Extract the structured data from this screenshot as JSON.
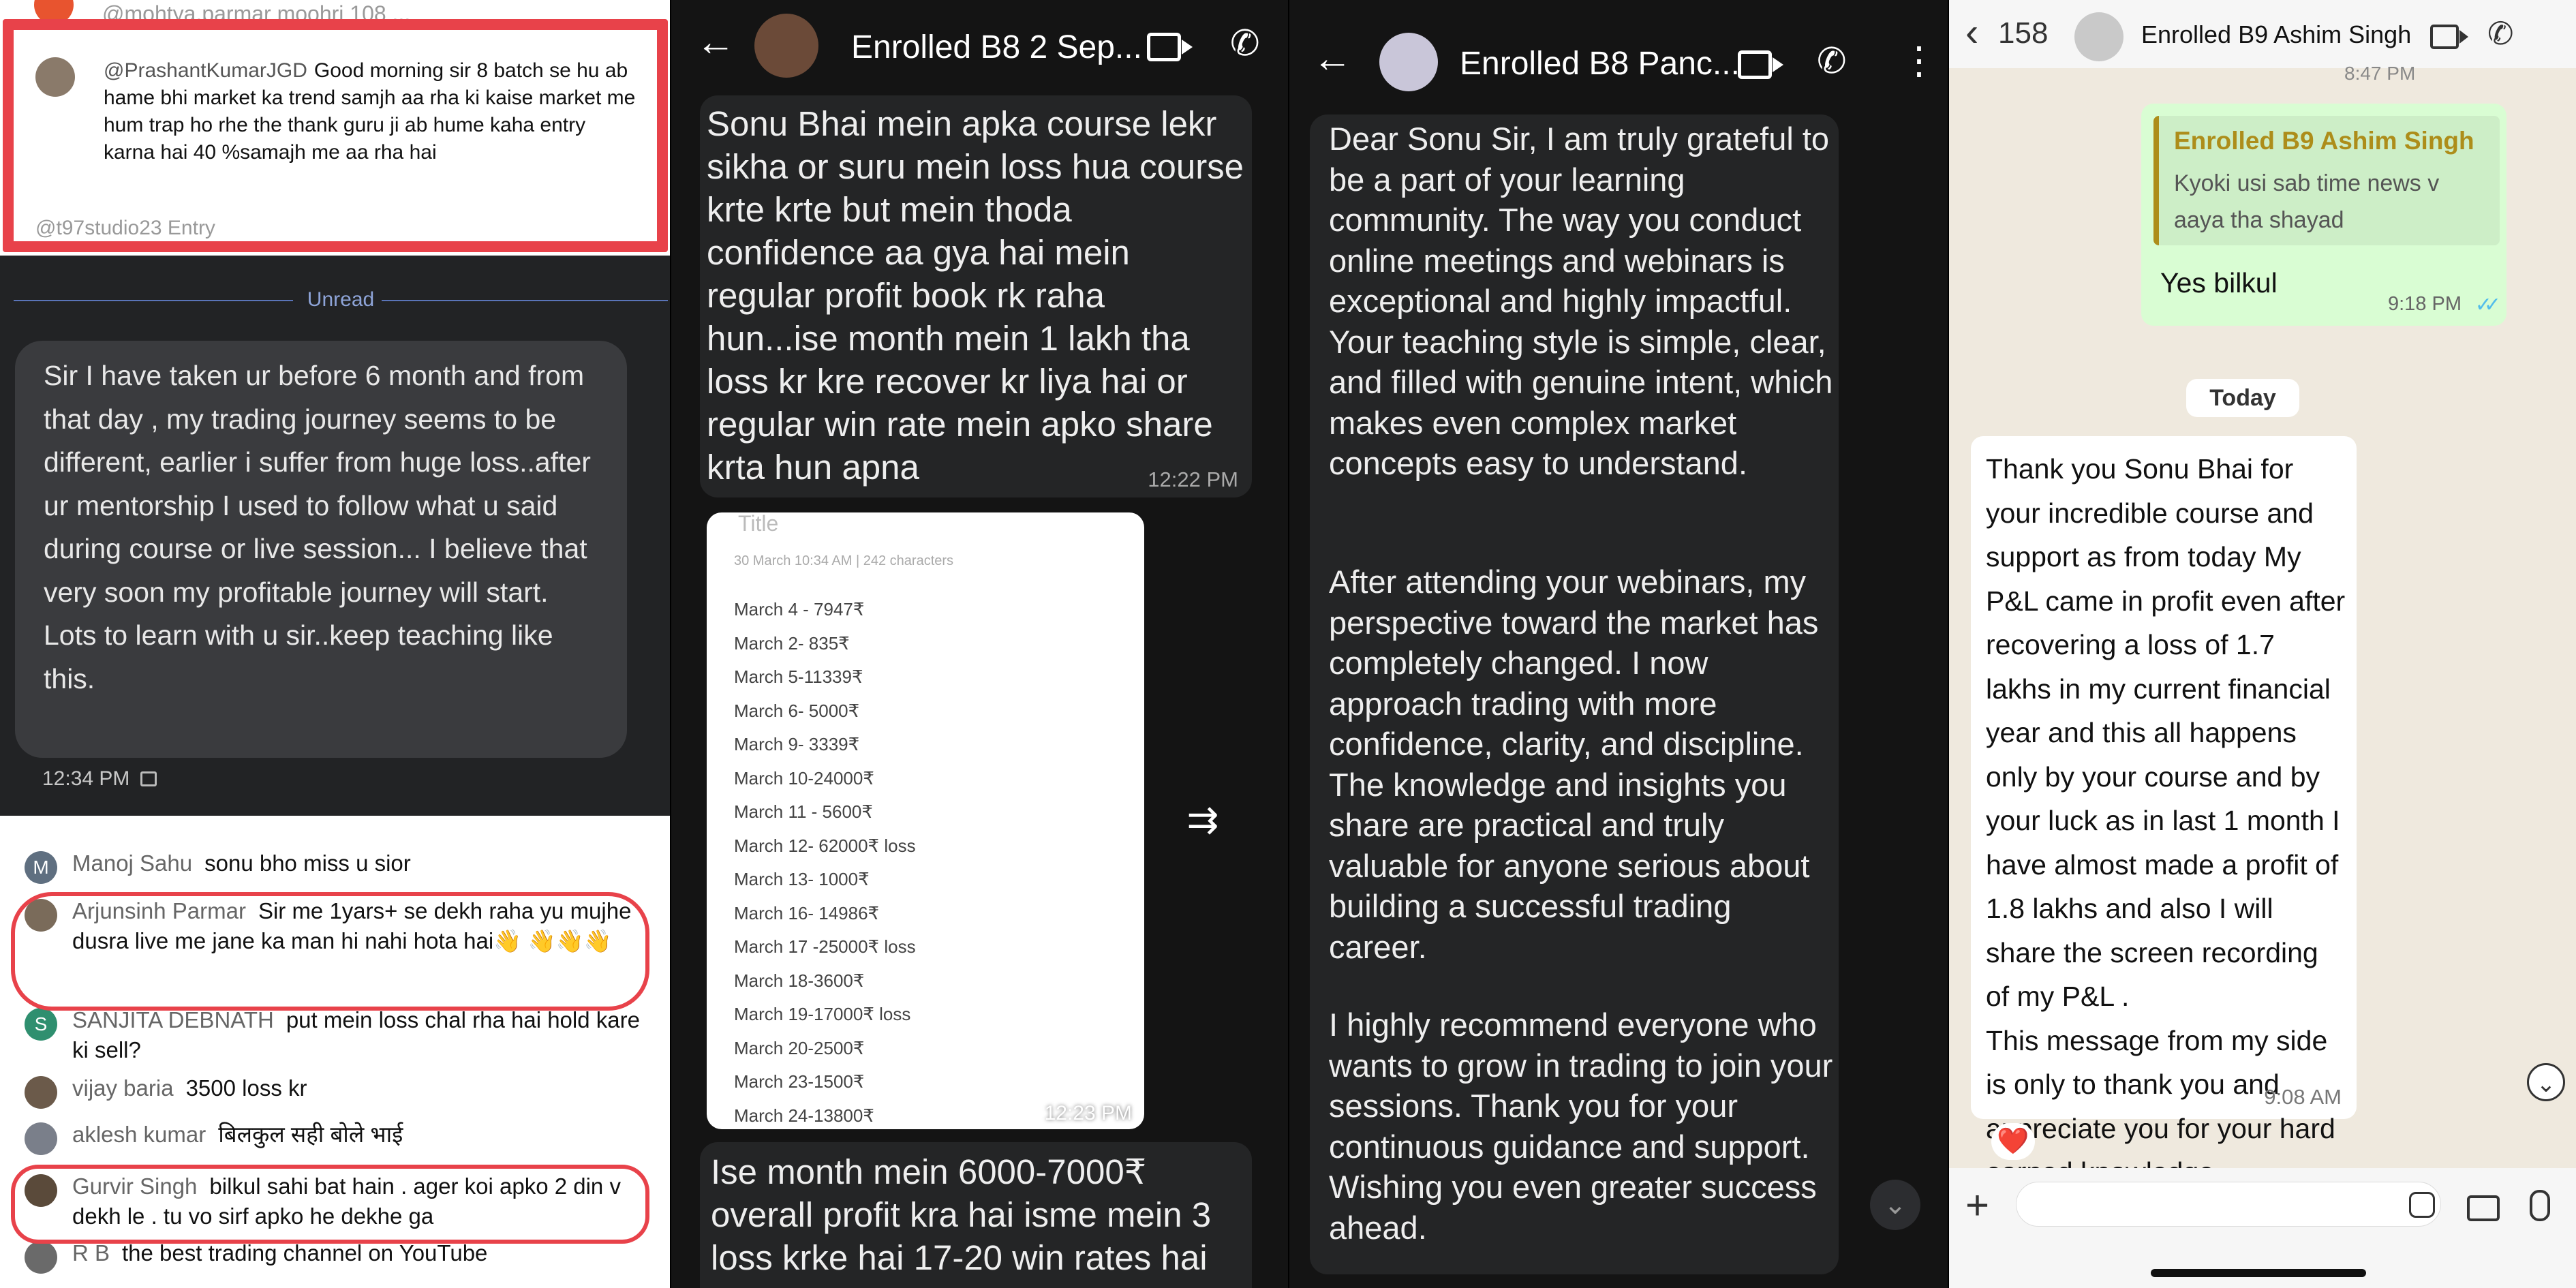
{
  "panel1": {
    "top_cut_text": "@mohtya.parmar  moohri   108  ...",
    "top_comment": {
      "handle": "@PrashantKumarJGD",
      "text": "Good morning sir 8 batch se hu ab hame bhi market ka trend samjh aa rha ki kaise market me hum trap ho rhe the thank guru ji ab hume kaha entry karna hai 40 %samajh me aa rha hai"
    },
    "cut_comment": "@t97studio23  Entry",
    "unread_label": "Unread",
    "message": "Sir I have taken ur before 6 month and from that day , my trading journey seems to be different, earlier i suffer from huge loss..after ur mentorship I used to follow what u said during course or live session... I believe that very soon my profitable journey will start.\nLots to learn with u sir..keep teaching like this.",
    "message_time": "12:34 PM",
    "comments": [
      {
        "avatar": "M",
        "color": "#5f6f80",
        "name": "Manoj Sahu",
        "text": "sonu bho miss u sior"
      },
      {
        "avatar": "",
        "color": "#7a6b5a",
        "name": "Arjunsinh Parmar",
        "text": "Sir me 1yars+ se dekh raha yu mujhe dusra live me jane ka man hi nahi hota hai👋 👋👋👋"
      },
      {
        "avatar": "S",
        "color": "#2f8f6f",
        "name": "SANJITA DEBNATH",
        "text": "put mein loss chal rha hai hold kare ki sell?"
      },
      {
        "avatar": "",
        "color": "#6b5a4a",
        "name": "vijay baria",
        "text": "3500 loss kr"
      },
      {
        "avatar": "",
        "color": "#7a7f8a",
        "name": "aklesh kumar",
        "text": "बिलकुल सही बोले भाई"
      },
      {
        "avatar": "",
        "color": "#5a4a3a",
        "name": "Gurvir Singh",
        "text": "bilkul sahi bat hain . ager koi apko 2 din v dekh le . tu vo sirf apko he dekhe ga"
      },
      {
        "avatar": "",
        "color": "#6a6a6a",
        "name": "R B",
        "text": "the best trading channel on YouTube"
      }
    ]
  },
  "panel2": {
    "title": "Enrolled B8 2 Sep...",
    "msg1": "Sonu Bhai mein apka course lekr sikha or suru mein loss hua course krte krte but mein thoda confidence aa gya hai mein regular profit book rk raha hun...ise month mein 1 lakh tha loss kr kre recover kr liya hai or regular win rate mein apko share krta hun apna",
    "msg1_time": "12:22 PM",
    "image": {
      "title": "Title",
      "meta": "30 March 10:34 AM   |   242 characters",
      "lines": [
        "March 4 - 7947₹",
        "March 2- 835₹",
        "March 5-11339₹",
        "March 6- 5000₹",
        "March 9- 3339₹",
        "March 10-24000₹",
        "March 11 - 5600₹",
        "March 12- 62000₹ loss",
        "March 13- 1000₹",
        "March 16- 14986₹",
        "March 17 -25000₹ loss",
        "March 18-3600₹",
        "March 19-17000₹ loss",
        "March 20-2500₹",
        "March 23-1500₹",
        "March 24-13800₹"
      ],
      "time": "12:23 PM"
    },
    "msg2": "Ise month mein 6000-7000₹ overall profit kra hai isme mein 3 loss krke hai 17-20 win rates hai"
  },
  "panel3": {
    "title": "Enrolled B8 Panc...",
    "paragraphs": [
      "Dear Sonu Sir, I am truly grateful to be a part of your learning community. The way you conduct online meetings and webinars is exceptional and highly impactful. Your teaching style is simple, clear, and filled with genuine intent, which makes even complex market concepts easy to understand.",
      "After attending your webinars, my perspective toward the market has completely changed. I now approach trading with more confidence, clarity, and discipline. The knowledge and insights you share are practical and truly valuable for anyone serious about building a successful trading career.",
      "I highly recommend everyone who wants to grow in trading to join your sessions. Thank you for your continuous guidance and support. Wishing you even greater success ahead."
    ]
  },
  "panel4": {
    "back_count": "158",
    "title": "Enrolled B9 Ashim Singh",
    "quote_name": "Enrolled B9 Ashim Singh",
    "quote_text": "Kyoki usi sab time news v aaya tha shayad",
    "reply": "Yes bilkul",
    "reply_time": "9:18 PM",
    "date_chip": "Today",
    "message": "Thank you Sonu Bhai for your incredible course and support as from today My P&L came in profit even after recovering a loss of 1.7 lakhs in my current financial year and this all happens only by your course and by your luck as in last 1 month I have almost made a profit of 1.8 lakhs and also I will share the screen recording of my P&L .\nThis message from my side is only to thank you and appreciate you for your hard earned knowledge.\nRegards,\nAshim Singh",
    "message_time": "9:08 AM",
    "reaction": "❤️",
    "top_cut_time": "8:47 PM"
  }
}
